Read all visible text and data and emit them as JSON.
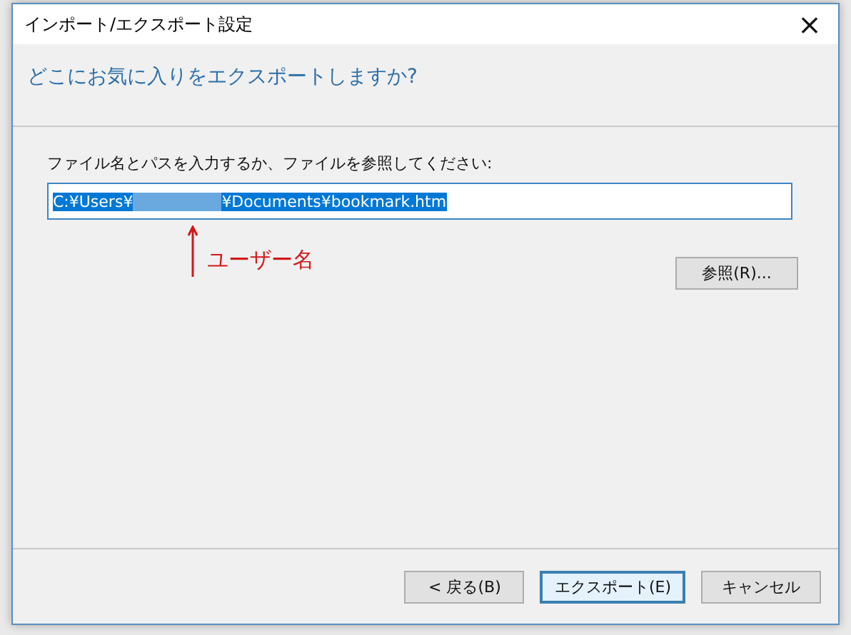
{
  "window": {
    "title": "インポート/エクスポート設定",
    "close": "×"
  },
  "heading": "どこにお気に入りをエクスポートしますか?",
  "path_field": {
    "label": "ファイル名とパスを入力するか、ファイルを参照してください:",
    "value_before": "C:¥Users¥",
    "value_after": "¥Documents¥bookmark.htm",
    "selected": true
  },
  "annotation": {
    "label": "ユーザー名"
  },
  "browse_button": "参照(R)...",
  "buttons": [
    {
      "label": "< 戻る(B)",
      "default": false
    },
    {
      "label": "エクスポート(E)",
      "default": true
    },
    {
      "label": "キャンセル",
      "default": false
    }
  ]
}
